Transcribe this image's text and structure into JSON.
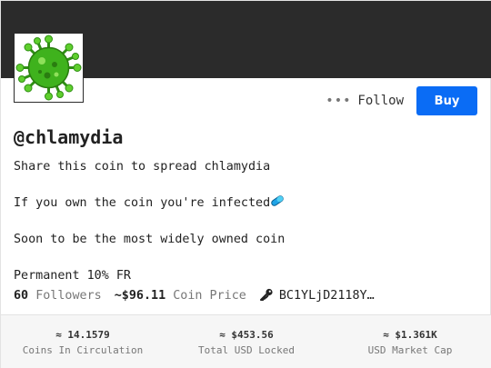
{
  "profile": {
    "handle": "@chlamydia",
    "avatar_icon": "virus-icon",
    "description": [
      "Share this coin to spread chlamydia",
      "If you own the coin you're infected",
      "Soon to be the most widely owned coin",
      "Permanent 10% FR"
    ]
  },
  "actions": {
    "more_label": "•••",
    "follow_label": "Follow",
    "buy_label": "Buy"
  },
  "stats": {
    "followers_count": "60",
    "followers_label": "Followers",
    "coin_price": "~$96.11",
    "coin_price_label": "Coin Price",
    "address": "BC1YLjD2118Y…"
  },
  "footer": {
    "circulation_value": "≈ 14.1579",
    "circulation_label": "Coins In Circulation",
    "locked_value": "≈ $453.56",
    "locked_label": "Total USD Locked",
    "marketcap_value": "≈ $1.361K",
    "marketcap_label": "USD Market Cap"
  },
  "colors": {
    "banner": "#2b2b2b",
    "buy_button": "#0a6cf5",
    "virus": "#3fb21d"
  }
}
